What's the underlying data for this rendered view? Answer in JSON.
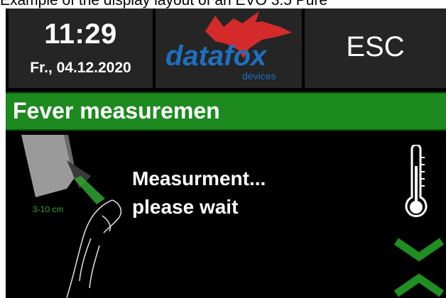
{
  "caption": "Example of the display layout of an EVO 3.5 Pure",
  "header": {
    "time": "11:29",
    "date": "Fr., 04.12.2020",
    "logo": {
      "brand": "datafox",
      "sub": "devices"
    },
    "esc_label": "ESC"
  },
  "title": "Fever measuremen",
  "content": {
    "distance_label": "3-10 cm",
    "message_line1": "Measurment...",
    "message_line2": "please wait"
  },
  "colors": {
    "title_bar": "#1c8a1e",
    "tile": "#252525",
    "logo_blue": "#1f6fbf",
    "logo_red": "#d42a2a",
    "chevron": "#1f8f22"
  },
  "icons": [
    "thermometer-icon",
    "chevron-down-icon",
    "chevron-up-icon",
    "logo-fox-icon"
  ]
}
